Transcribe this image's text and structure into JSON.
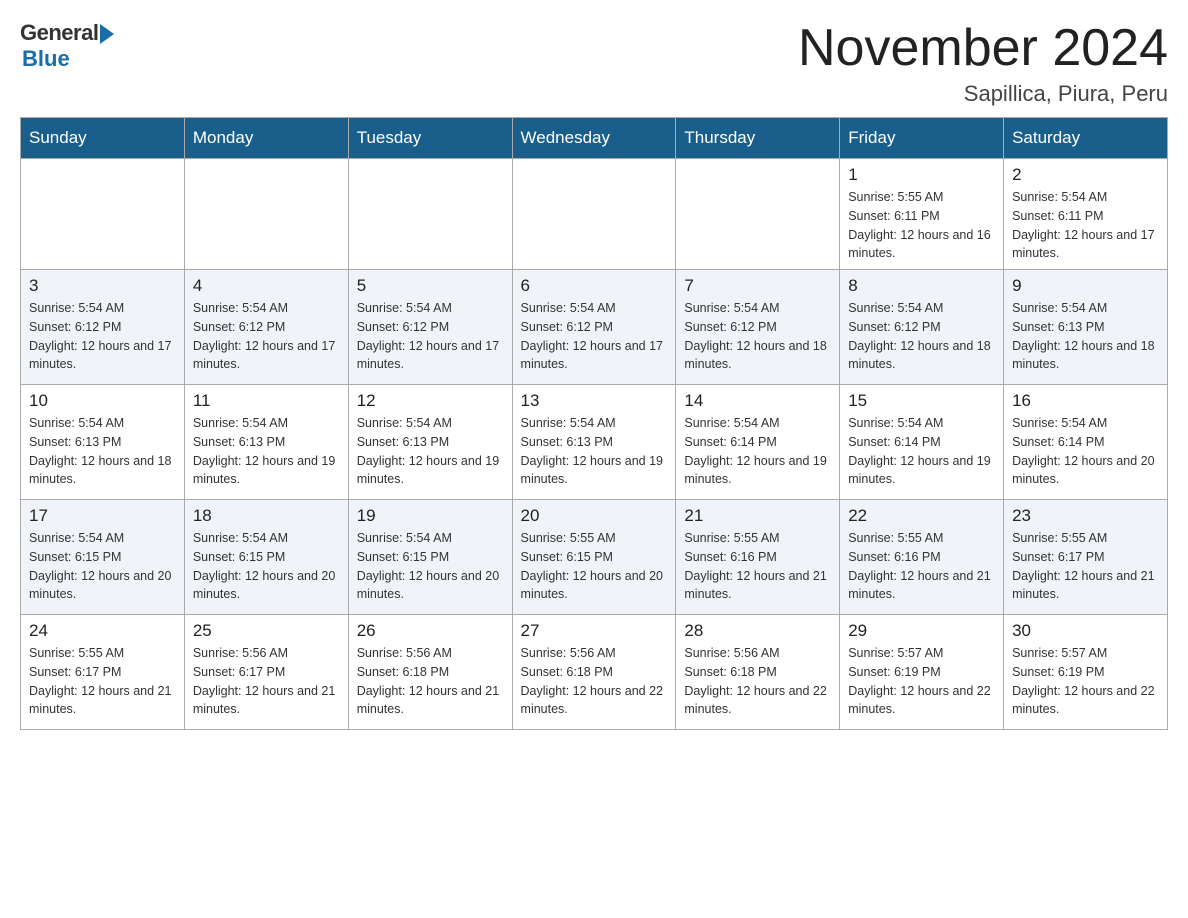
{
  "header": {
    "logo_general": "General",
    "logo_blue": "Blue",
    "title": "November 2024",
    "location": "Sapillica, Piura, Peru"
  },
  "days_of_week": [
    "Sunday",
    "Monday",
    "Tuesday",
    "Wednesday",
    "Thursday",
    "Friday",
    "Saturday"
  ],
  "weeks": [
    [
      {
        "day": "",
        "sunrise": "",
        "sunset": "",
        "daylight": ""
      },
      {
        "day": "",
        "sunrise": "",
        "sunset": "",
        "daylight": ""
      },
      {
        "day": "",
        "sunrise": "",
        "sunset": "",
        "daylight": ""
      },
      {
        "day": "",
        "sunrise": "",
        "sunset": "",
        "daylight": ""
      },
      {
        "day": "",
        "sunrise": "",
        "sunset": "",
        "daylight": ""
      },
      {
        "day": "1",
        "sunrise": "Sunrise: 5:55 AM",
        "sunset": "Sunset: 6:11 PM",
        "daylight": "Daylight: 12 hours and 16 minutes."
      },
      {
        "day": "2",
        "sunrise": "Sunrise: 5:54 AM",
        "sunset": "Sunset: 6:11 PM",
        "daylight": "Daylight: 12 hours and 17 minutes."
      }
    ],
    [
      {
        "day": "3",
        "sunrise": "Sunrise: 5:54 AM",
        "sunset": "Sunset: 6:12 PM",
        "daylight": "Daylight: 12 hours and 17 minutes."
      },
      {
        "day": "4",
        "sunrise": "Sunrise: 5:54 AM",
        "sunset": "Sunset: 6:12 PM",
        "daylight": "Daylight: 12 hours and 17 minutes."
      },
      {
        "day": "5",
        "sunrise": "Sunrise: 5:54 AM",
        "sunset": "Sunset: 6:12 PM",
        "daylight": "Daylight: 12 hours and 17 minutes."
      },
      {
        "day": "6",
        "sunrise": "Sunrise: 5:54 AM",
        "sunset": "Sunset: 6:12 PM",
        "daylight": "Daylight: 12 hours and 17 minutes."
      },
      {
        "day": "7",
        "sunrise": "Sunrise: 5:54 AM",
        "sunset": "Sunset: 6:12 PM",
        "daylight": "Daylight: 12 hours and 18 minutes."
      },
      {
        "day": "8",
        "sunrise": "Sunrise: 5:54 AM",
        "sunset": "Sunset: 6:12 PM",
        "daylight": "Daylight: 12 hours and 18 minutes."
      },
      {
        "day": "9",
        "sunrise": "Sunrise: 5:54 AM",
        "sunset": "Sunset: 6:13 PM",
        "daylight": "Daylight: 12 hours and 18 minutes."
      }
    ],
    [
      {
        "day": "10",
        "sunrise": "Sunrise: 5:54 AM",
        "sunset": "Sunset: 6:13 PM",
        "daylight": "Daylight: 12 hours and 18 minutes."
      },
      {
        "day": "11",
        "sunrise": "Sunrise: 5:54 AM",
        "sunset": "Sunset: 6:13 PM",
        "daylight": "Daylight: 12 hours and 19 minutes."
      },
      {
        "day": "12",
        "sunrise": "Sunrise: 5:54 AM",
        "sunset": "Sunset: 6:13 PM",
        "daylight": "Daylight: 12 hours and 19 minutes."
      },
      {
        "day": "13",
        "sunrise": "Sunrise: 5:54 AM",
        "sunset": "Sunset: 6:13 PM",
        "daylight": "Daylight: 12 hours and 19 minutes."
      },
      {
        "day": "14",
        "sunrise": "Sunrise: 5:54 AM",
        "sunset": "Sunset: 6:14 PM",
        "daylight": "Daylight: 12 hours and 19 minutes."
      },
      {
        "day": "15",
        "sunrise": "Sunrise: 5:54 AM",
        "sunset": "Sunset: 6:14 PM",
        "daylight": "Daylight: 12 hours and 19 minutes."
      },
      {
        "day": "16",
        "sunrise": "Sunrise: 5:54 AM",
        "sunset": "Sunset: 6:14 PM",
        "daylight": "Daylight: 12 hours and 20 minutes."
      }
    ],
    [
      {
        "day": "17",
        "sunrise": "Sunrise: 5:54 AM",
        "sunset": "Sunset: 6:15 PM",
        "daylight": "Daylight: 12 hours and 20 minutes."
      },
      {
        "day": "18",
        "sunrise": "Sunrise: 5:54 AM",
        "sunset": "Sunset: 6:15 PM",
        "daylight": "Daylight: 12 hours and 20 minutes."
      },
      {
        "day": "19",
        "sunrise": "Sunrise: 5:54 AM",
        "sunset": "Sunset: 6:15 PM",
        "daylight": "Daylight: 12 hours and 20 minutes."
      },
      {
        "day": "20",
        "sunrise": "Sunrise: 5:55 AM",
        "sunset": "Sunset: 6:15 PM",
        "daylight": "Daylight: 12 hours and 20 minutes."
      },
      {
        "day": "21",
        "sunrise": "Sunrise: 5:55 AM",
        "sunset": "Sunset: 6:16 PM",
        "daylight": "Daylight: 12 hours and 21 minutes."
      },
      {
        "day": "22",
        "sunrise": "Sunrise: 5:55 AM",
        "sunset": "Sunset: 6:16 PM",
        "daylight": "Daylight: 12 hours and 21 minutes."
      },
      {
        "day": "23",
        "sunrise": "Sunrise: 5:55 AM",
        "sunset": "Sunset: 6:17 PM",
        "daylight": "Daylight: 12 hours and 21 minutes."
      }
    ],
    [
      {
        "day": "24",
        "sunrise": "Sunrise: 5:55 AM",
        "sunset": "Sunset: 6:17 PM",
        "daylight": "Daylight: 12 hours and 21 minutes."
      },
      {
        "day": "25",
        "sunrise": "Sunrise: 5:56 AM",
        "sunset": "Sunset: 6:17 PM",
        "daylight": "Daylight: 12 hours and 21 minutes."
      },
      {
        "day": "26",
        "sunrise": "Sunrise: 5:56 AM",
        "sunset": "Sunset: 6:18 PM",
        "daylight": "Daylight: 12 hours and 21 minutes."
      },
      {
        "day": "27",
        "sunrise": "Sunrise: 5:56 AM",
        "sunset": "Sunset: 6:18 PM",
        "daylight": "Daylight: 12 hours and 22 minutes."
      },
      {
        "day": "28",
        "sunrise": "Sunrise: 5:56 AM",
        "sunset": "Sunset: 6:18 PM",
        "daylight": "Daylight: 12 hours and 22 minutes."
      },
      {
        "day": "29",
        "sunrise": "Sunrise: 5:57 AM",
        "sunset": "Sunset: 6:19 PM",
        "daylight": "Daylight: 12 hours and 22 minutes."
      },
      {
        "day": "30",
        "sunrise": "Sunrise: 5:57 AM",
        "sunset": "Sunset: 6:19 PM",
        "daylight": "Daylight: 12 hours and 22 minutes."
      }
    ]
  ]
}
